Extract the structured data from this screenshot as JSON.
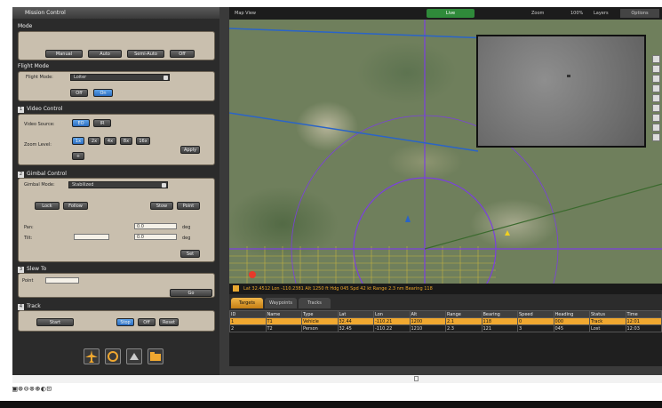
{
  "window": {
    "title": "Mission Control"
  },
  "left_panel": {
    "title": "Mission Control",
    "group1": {
      "label": "Mode",
      "buttons": [
        "Manual",
        "Auto",
        "Semi-Auto",
        "Off"
      ]
    },
    "group2": {
      "label": "Flight Mode",
      "dropdown_label": "Flight Mode:",
      "dropdown_value": "Loiter",
      "buttons": [
        "Off",
        "On"
      ]
    },
    "group3": {
      "num": "1",
      "label": "Video Control",
      "row1_label": "Video Source:",
      "row1_buttons": [
        "EO",
        "IR"
      ],
      "row2_label": "Zoom Level:",
      "row2_buttons": [
        "1x",
        "2x",
        "4x",
        "8x",
        "16x"
      ],
      "apply": "Apply",
      "extra": "+"
    },
    "group4": {
      "num": "2",
      "label": "Gimbal Control",
      "dropdown_label": "Gimbal Mode:",
      "dropdown_value": "Stabilized",
      "buttons": [
        "Lock",
        "Follow",
        "Stow",
        "Point"
      ],
      "pan_label": "Pan:",
      "tilt_label": "Tilt:",
      "pan_value": "0.0",
      "tilt_value": "0.0",
      "pan_unit": "deg",
      "tilt_unit": "deg",
      "set": "Set"
    },
    "group5": {
      "num": "3",
      "label": "Slew To",
      "option": "Point",
      "value": "",
      "go": "Go"
    },
    "group6": {
      "num": "4",
      "label": "Track",
      "buttons": [
        "Start",
        "Stop",
        "Off",
        "Reset"
      ]
    },
    "toolbar_icons": [
      "aircraft-icon",
      "camera-icon",
      "gimbal-icon",
      "folder-icon"
    ]
  },
  "map": {
    "header_left": "Map View",
    "header_tab": "Live",
    "header_right": [
      "Zoom",
      "100%",
      "Layers",
      "Options"
    ],
    "inset_label": "Video Feed"
  },
  "status": {
    "text": "Lat 32.4512 Lon -110.2381   Alt 1250 ft   Hdg 045   Spd 42 kt   Range 2.3 nm   Bearing 118"
  },
  "tabs": [
    "Targets",
    "Waypoints",
    "Tracks"
  ],
  "table": {
    "columns": [
      "ID",
      "Name",
      "Type",
      "Lat",
      "Lon",
      "Alt",
      "Range",
      "Bearing",
      "Speed",
      "Heading",
      "Status",
      "Time"
    ],
    "rows": [
      [
        "1",
        "T1",
        "Vehicle",
        "32.44",
        "-110.21",
        "1200",
        "2.1",
        "118",
        "0",
        "000",
        "Track",
        "12:01"
      ],
      [
        "2",
        "T2",
        "Person",
        "32.45",
        "-110.22",
        "1210",
        "2.3",
        "121",
        "3",
        "045",
        "Lost",
        "12:03"
      ]
    ]
  },
  "bottom": {
    "icons": "▣⊕⊖⊚⊛◐⊡"
  },
  "colors": {
    "accent": "#f0a830",
    "blue_button": "#2b6cc0",
    "panel_bg": "#c9bfae",
    "circle": "#7b3fe0"
  }
}
